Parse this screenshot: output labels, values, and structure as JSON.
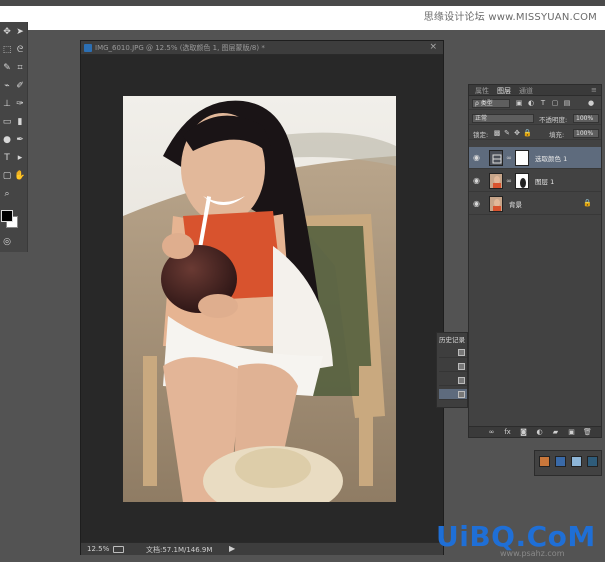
{
  "watermark_top": "思缘设计论坛 www.MISSYUAN.COM",
  "watermark_bottom": "UiBQ.CoM",
  "watermark_bottom_sub": "www.psahz.com",
  "document": {
    "tab_title": "IMG_6010.JPG @ 12.5% (选取颜色 1, 图层蒙版/8) *",
    "zoom": "12.5%",
    "doc_info": "文档:57.1M/146.9M"
  },
  "layers_panel": {
    "tabs": [
      {
        "label": "属性",
        "active": false
      },
      {
        "label": "图层",
        "active": true
      },
      {
        "label": "通道",
        "active": false
      }
    ],
    "filter_label": "ρ 类型",
    "blend_mode": "正常",
    "opacity_label": "不透明度:",
    "opacity_value": "100%",
    "lock_label": "锁定:",
    "fill_label": "填充:",
    "fill_value": "100%",
    "layers": [
      {
        "name": "选取颜色 1",
        "selected": true
      },
      {
        "name": "图层 1",
        "selected": false
      },
      {
        "name": "背景",
        "selected": false
      }
    ]
  },
  "history_panel": {
    "title": "历史记录"
  },
  "colors": {
    "ui_dark": "#535353",
    "panel": "#424242",
    "selected_row": "#5e6b7d",
    "watermark_blue": "#1f6fd6"
  }
}
